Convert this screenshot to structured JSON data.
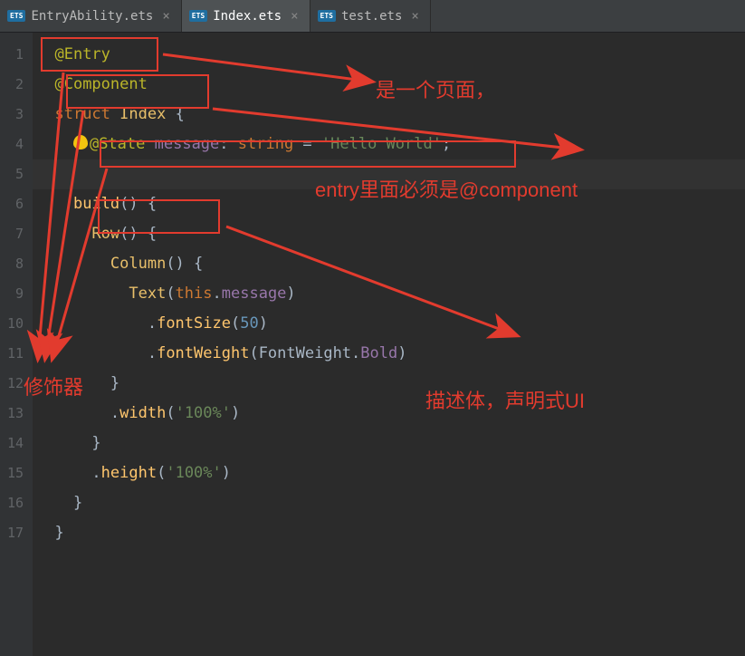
{
  "tabs": [
    {
      "icon": "ETS",
      "label": "EntryAbility.ets",
      "active": false
    },
    {
      "icon": "ETS",
      "label": "Index.ets",
      "active": true
    },
    {
      "icon": "ETS",
      "label": "test.ets",
      "active": false
    }
  ],
  "lineNumbers": [
    "1",
    "2",
    "3",
    "4",
    "5",
    "6",
    "7",
    "8",
    "9",
    "10",
    "11",
    "12",
    "13",
    "14",
    "15",
    "16",
    "17"
  ],
  "code": {
    "l1": {
      "dec": "@Entry"
    },
    "l2": {
      "dec": "@Component"
    },
    "l3": {
      "kw": "struct",
      "sp": " ",
      "id": "Index",
      "p": " {"
    },
    "l4": {
      "dec": "@State",
      "sp": " ",
      "id": "message",
      "c": ": ",
      "typ": "string",
      "eq": " = ",
      "str": "'Hello World'",
      "semi": ";"
    },
    "l5": {
      "blank": ""
    },
    "l6": {
      "fn": "build",
      "paren": "()",
      "brace": " {"
    },
    "l7": {
      "call": "Row",
      "paren": "()",
      "brace": " {"
    },
    "l8": {
      "call": "Column",
      "paren": "()",
      "brace": " {"
    },
    "l9": {
      "call": "Text",
      "open": "(",
      "kw": "this",
      "dot": ".",
      "id": "message",
      "close": ")"
    },
    "l10": {
      "dot": ".",
      "fn": "fontSize",
      "open": "(",
      "num": "50",
      "close": ")"
    },
    "l11": {
      "dot": ".",
      "fn": "fontWeight",
      "open": "(",
      "id1": "FontWeight",
      "dot2": ".",
      "id2": "Bold",
      "close": ")"
    },
    "l12": {
      "brace": "}"
    },
    "l13": {
      "dot": ".",
      "fn": "width",
      "open": "(",
      "str": "'100%'",
      "close": ")"
    },
    "l14": {
      "brace": "}"
    },
    "l15": {
      "dot": ".",
      "fn": "height",
      "open": "(",
      "str": "'100%'",
      "close": ")"
    },
    "l16": {
      "brace": "}"
    },
    "l17": {
      "brace": "}"
    }
  },
  "annotations": {
    "a1": "是一个页面，",
    "a2": "entry里面必须是@component",
    "a3": "修饰器",
    "a4": "描述体，声明式UI"
  }
}
